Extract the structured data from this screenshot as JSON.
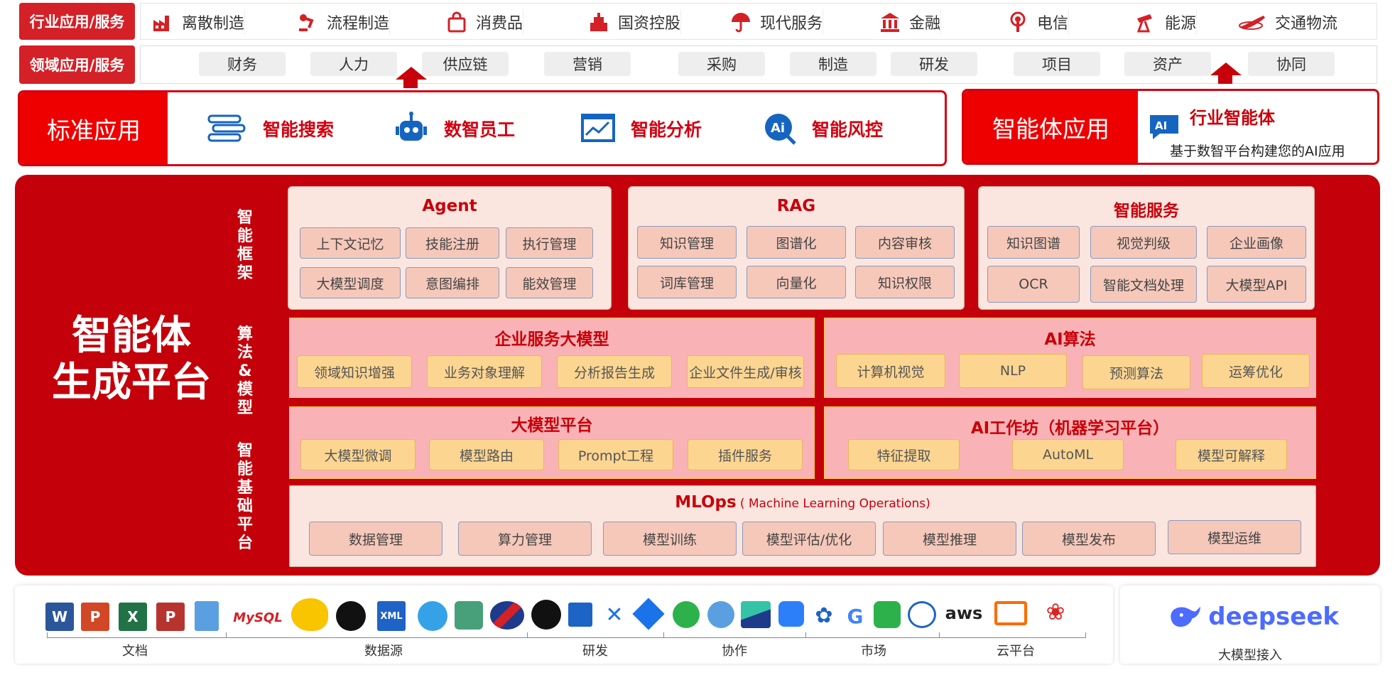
{
  "industry_row": {
    "label": "行业应用/服务",
    "items": [
      {
        "label": "离散制造",
        "icon": "factory-icon"
      },
      {
        "label": "流程制造",
        "icon": "robot-arm-icon"
      },
      {
        "label": "消费品",
        "icon": "shopping-bag-icon"
      },
      {
        "label": "国资控股",
        "icon": "government-building-icon"
      },
      {
        "label": "现代服务",
        "icon": "umbrella-icon"
      },
      {
        "label": "金融",
        "icon": "bank-icon"
      },
      {
        "label": "电信",
        "icon": "signal-tower-icon"
      },
      {
        "label": "能源",
        "icon": "oil-pump-icon"
      },
      {
        "label": "交通物流",
        "icon": "airplane-icon"
      }
    ]
  },
  "domain_row": {
    "label": "领域应用/服务",
    "items": [
      "财务",
      "人力",
      "供应链",
      "营销",
      "采购",
      "制造",
      "研发",
      "项目",
      "资产",
      "协同"
    ]
  },
  "standard_apps": {
    "label": "标准应用",
    "items": [
      {
        "label": "智能搜索",
        "icon": "database-search-icon"
      },
      {
        "label": "数智员工",
        "icon": "robot-icon"
      },
      {
        "label": "智能分析",
        "icon": "chart-monitor-icon"
      },
      {
        "label": "智能风控",
        "icon": "ai-search-icon"
      }
    ]
  },
  "agent_apps": {
    "label": "智能体应用",
    "title": "行业智能体",
    "badge": "AI",
    "desc": "基于数智平台构建您的AI应用"
  },
  "platform": {
    "title_line1": "智能体",
    "title_line2": "生成平台",
    "side_labels": [
      "智能框架",
      "算法&模型",
      "智能基础平台"
    ],
    "agent": {
      "title": "Agent",
      "cells": [
        "上下文记忆",
        "技能注册",
        "执行管理",
        "大模型调度",
        "意图编排",
        "能效管理"
      ]
    },
    "rag": {
      "title": "RAG",
      "cells": [
        "知识管理",
        "图谱化",
        "内容审核",
        "词库管理",
        "向量化",
        "知识权限"
      ]
    },
    "smart_service": {
      "title": "智能服务",
      "cells": [
        "知识图谱",
        "视觉判级",
        "企业画像",
        "OCR",
        "智能文档处理",
        "大模型API"
      ]
    },
    "enterprise_model": {
      "title": "企业服务大模型",
      "cells": [
        "领域知识增强",
        "业务对象理解",
        "分析报告生成",
        "企业文件生成/审核"
      ]
    },
    "ai_algo": {
      "title": "AI算法",
      "cells": [
        "计算机视觉",
        "NLP",
        "预测算法",
        "运筹优化"
      ]
    },
    "llm_platform": {
      "title": "大模型平台",
      "cells": [
        "大模型微调",
        "模型路由",
        "Prompt工程",
        "插件服务"
      ]
    },
    "ai_workshop": {
      "title": "AI工作坊（机器学习平台）",
      "cells": [
        "特征提取",
        "AutoML",
        "模型可解释"
      ]
    },
    "mlops": {
      "title": "MLOps",
      "subtitle": "( Machine Learning Operations)",
      "cells": [
        "数据管理",
        "算力管理",
        "模型训练",
        "模型评估/优化",
        "模型推理",
        "模型发布",
        "模型运维"
      ]
    }
  },
  "sources": {
    "categories": [
      "文档",
      "数据源",
      "研发",
      "协作",
      "市场",
      "云平台"
    ],
    "logos": {
      "mysql": "MySQL",
      "xml": "XML",
      "aws": "aws",
      "g": "G"
    }
  },
  "llm_access": {
    "brand": "deepseek",
    "label": "大模型接入"
  },
  "colors": {
    "brand_red": "#d42027",
    "dark_red": "#c4000a",
    "bright_red": "#ee0000"
  }
}
